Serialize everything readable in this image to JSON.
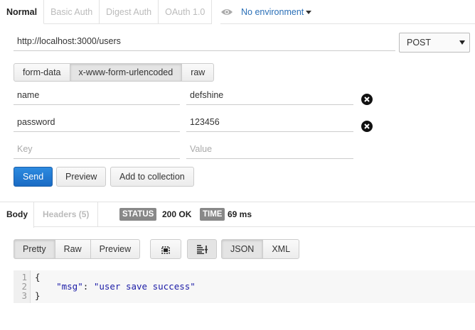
{
  "auth_tabs": [
    {
      "label": "Normal"
    },
    {
      "label": "Basic Auth"
    },
    {
      "label": "Digest Auth"
    },
    {
      "label": "OAuth 1.0"
    }
  ],
  "environment": {
    "label": "No environment"
  },
  "request": {
    "url": "http://localhost:3000/users",
    "method": "POST"
  },
  "body_types": [
    {
      "label": "form-data"
    },
    {
      "label": "x-www-form-urlencoded"
    },
    {
      "label": "raw"
    }
  ],
  "params": [
    {
      "key": "name",
      "value": "defshine"
    },
    {
      "key": "password",
      "value": "123456"
    }
  ],
  "new_param": {
    "key_placeholder": "Key",
    "value_placeholder": "Value"
  },
  "actions": {
    "send": "Send",
    "preview": "Preview",
    "add_to_collection": "Add to collection"
  },
  "response": {
    "tab_body": "Body",
    "tab_headers": "Headers (5)",
    "status_badge": "STATUS",
    "status_value": "200 OK",
    "time_badge": "TIME",
    "time_value": "69 ms"
  },
  "viewer": {
    "modes": [
      {
        "label": "Pretty"
      },
      {
        "label": "Raw"
      },
      {
        "label": "Preview"
      }
    ],
    "formats": [
      {
        "label": "JSON"
      },
      {
        "label": "XML"
      }
    ]
  },
  "code": {
    "line_numbers": [
      "1",
      "2",
      "3"
    ],
    "open": "{",
    "key": "\"msg\"",
    "sep": ": ",
    "value": "\"user save success\"",
    "close": "}"
  },
  "colors": {
    "send_button": "#1a6bc4",
    "env_link": "#2a6fb7",
    "badge": "#888888"
  }
}
